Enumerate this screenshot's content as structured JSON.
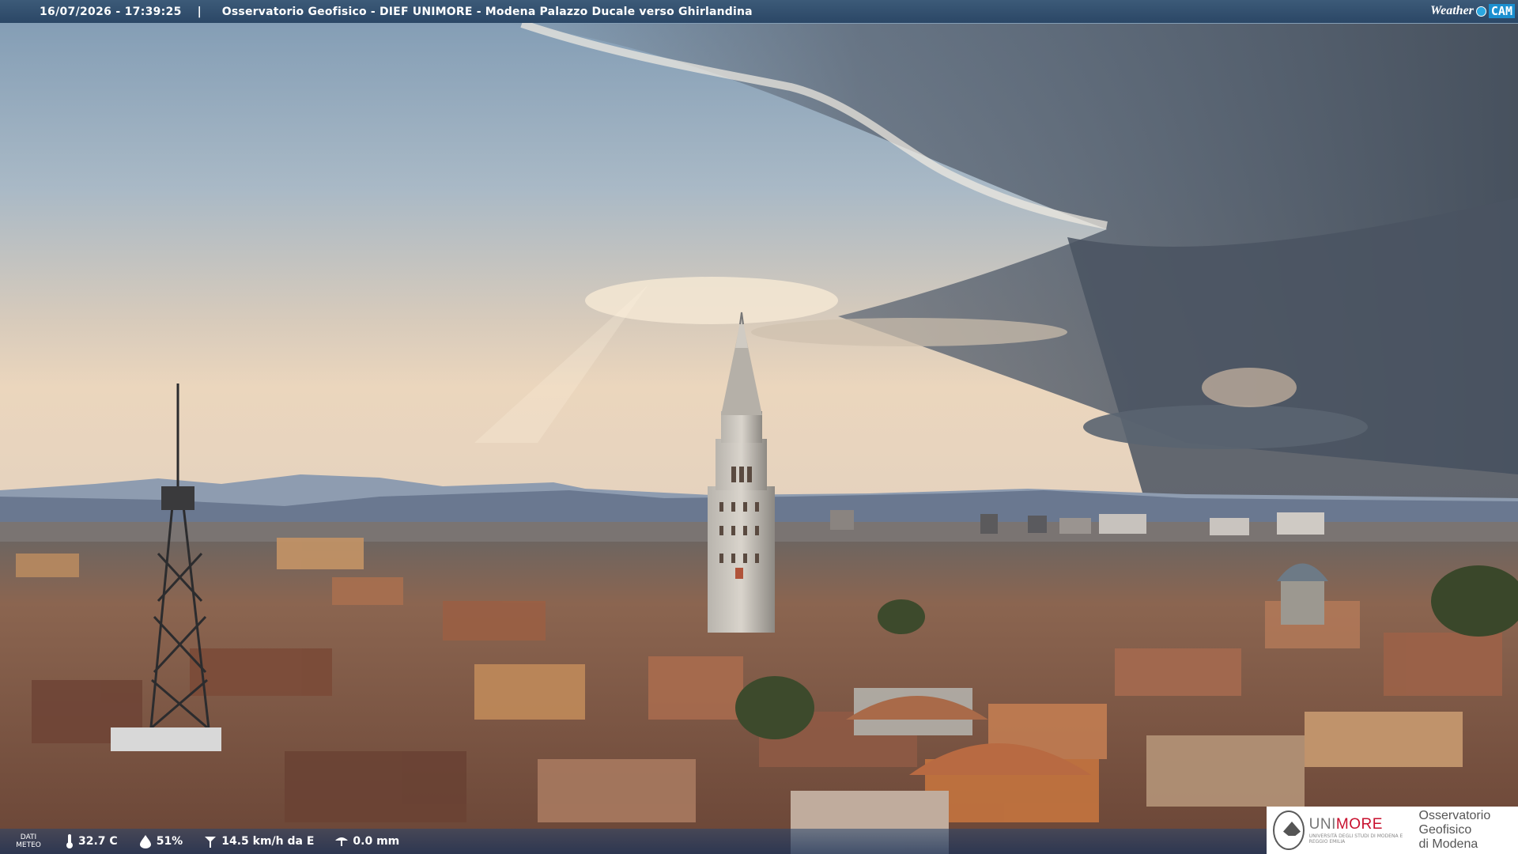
{
  "overlay": {
    "timestamp": "16/07/2026 - 17:39:25",
    "separator": "|",
    "location": "Osservatorio Geofisico - DIEF UNIMORE - Modena Palazzo Ducale verso Ghirlandina"
  },
  "logo": {
    "part1": "Weather",
    "part2": "CAM"
  },
  "weather": {
    "label": "DATI METEO",
    "temperature": "32.7 C",
    "humidity": "51%",
    "wind": "14.5 km/h da E",
    "rain": "0.0 mm"
  },
  "institution": {
    "brand_uni": "UNI",
    "brand_more": "MORE",
    "brand_sub": "UNIVERSITÀ DEGLI STUDI DI MODENA E REGGIO EMILIA",
    "name_line1": "Osservatorio Geofisico",
    "name_line2": "di Modena"
  },
  "colors": {
    "sky_top": "#8fa6bd",
    "horizon": "#e8d4b8",
    "roofs": "#8a5a44",
    "storm": "#4d5866"
  },
  "icons": [
    "thermometer-icon",
    "humidity-icon",
    "wind-icon",
    "rain-icon"
  ]
}
